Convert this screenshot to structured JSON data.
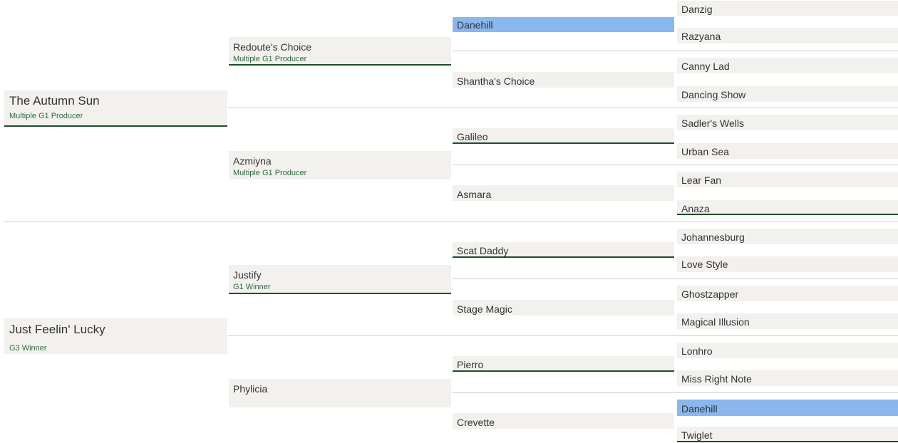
{
  "pedigree": {
    "gen1": [
      {
        "name": "The Autumn Sun",
        "note": "Multiple G1 Producer"
      },
      {
        "name": "Just Feelin' Lucky",
        "note": "G3 Winner"
      }
    ],
    "gen2": [
      {
        "name": "Redoute's Choice",
        "note": "Multiple G1 Producer"
      },
      {
        "name": "Azmiyna",
        "note": "Multiple G1 Producer"
      },
      {
        "name": "Justify",
        "note": "G1 Winner"
      },
      {
        "name": "Phylicia",
        "note": ""
      }
    ],
    "gen3": [
      {
        "name": "Danehill"
      },
      {
        "name": "Shantha's Choice"
      },
      {
        "name": "Galileo"
      },
      {
        "name": "Asmara"
      },
      {
        "name": "Scat Daddy"
      },
      {
        "name": "Stage Magic"
      },
      {
        "name": "Pierro"
      },
      {
        "name": "Crevette"
      }
    ],
    "gen4": [
      {
        "name": "Danzig"
      },
      {
        "name": "Razyana"
      },
      {
        "name": "Canny Lad"
      },
      {
        "name": "Dancing Show"
      },
      {
        "name": "Sadler's Wells"
      },
      {
        "name": "Urban Sea"
      },
      {
        "name": "Lear Fan"
      },
      {
        "name": "Anaza"
      },
      {
        "name": "Johannesburg"
      },
      {
        "name": "Love Style"
      },
      {
        "name": "Ghostzapper"
      },
      {
        "name": "Magical Illusion"
      },
      {
        "name": "Lonhro"
      },
      {
        "name": "Miss Right Note"
      },
      {
        "name": "Danehill"
      },
      {
        "name": "Twiglet"
      }
    ]
  },
  "colors": {
    "cell_background": "#f3f1ee",
    "highlight": "#8ab7ee",
    "underline": "#1e4d2b",
    "note_text": "#2e6a3e",
    "separator": "#cfcfcf"
  }
}
